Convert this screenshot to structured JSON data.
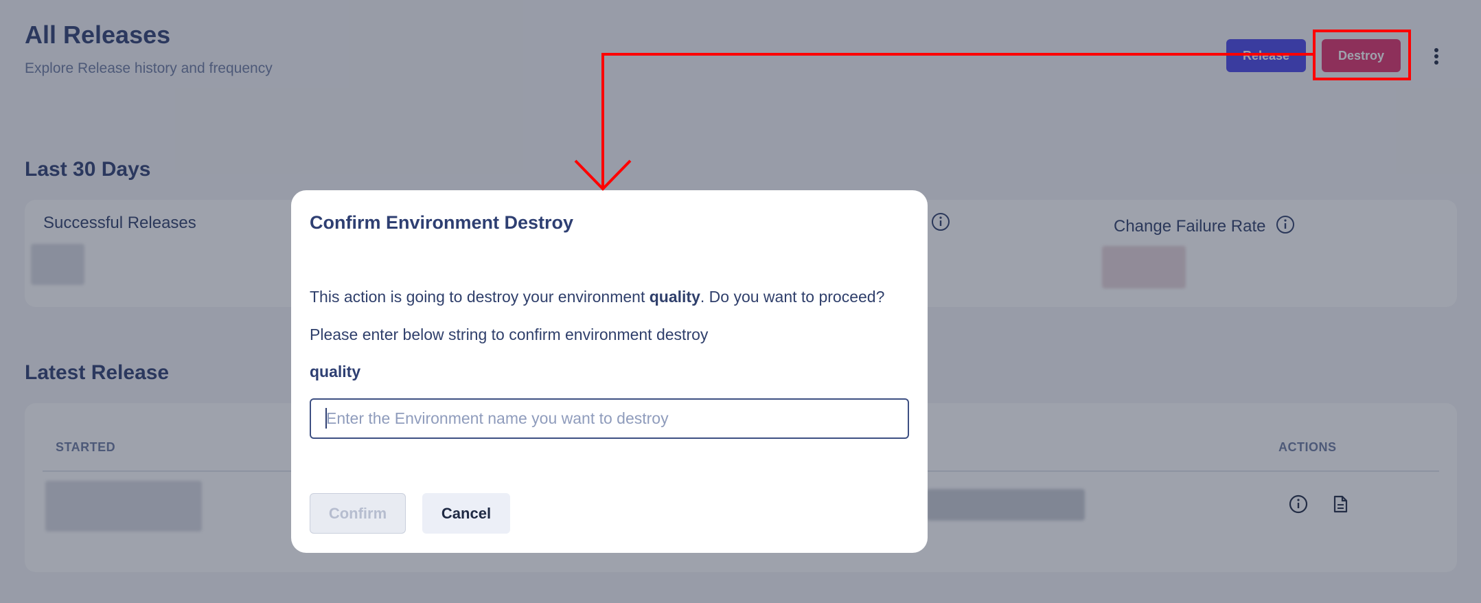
{
  "header": {
    "title": "All Releases",
    "subtitle": "Explore Release history and frequency",
    "release_label": "Release",
    "destroy_label": "Destroy"
  },
  "last30": {
    "title": "Last 30 Days",
    "metrics": [
      {
        "label": "Successful Releases"
      },
      {
        "label": "Change Failure Rate"
      }
    ]
  },
  "latest": {
    "title": "Latest Release",
    "columns": [
      "STARTED",
      "ACTIONS"
    ]
  },
  "modal": {
    "title": "Confirm Environment Destroy",
    "message_prefix": "This action is going to destroy your environment ",
    "env_name": "quality",
    "message_suffix": ". Do you want to proceed?",
    "instruction": "Please enter below string to confirm environment destroy",
    "confirm_string": "quality",
    "input_placeholder": "Enter the Environment name you want to destroy",
    "input_value": "",
    "confirm_label": "Confirm",
    "cancel_label": "Cancel"
  },
  "colors": {
    "accent": "#4a45e8",
    "danger": "#e0306a",
    "annotation": "#ff0000"
  }
}
